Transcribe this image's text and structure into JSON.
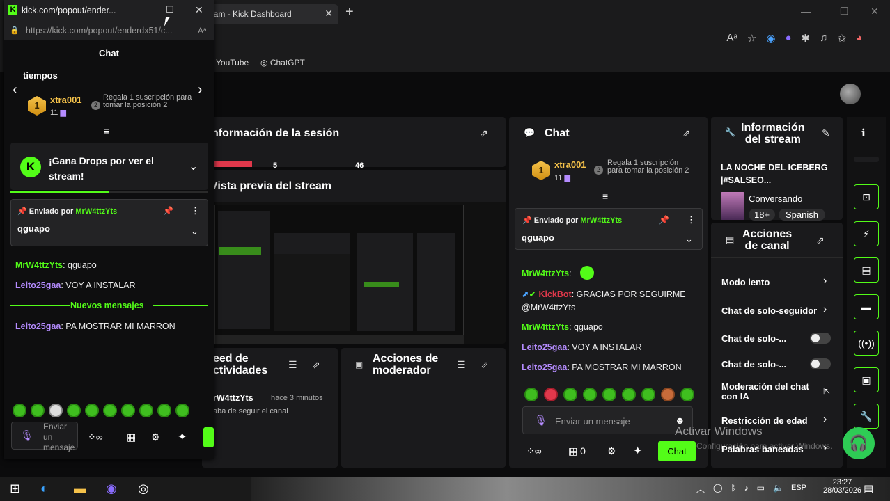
{
  "background_browser": {
    "tab_title": "eam - Kick Dashboard",
    "bookmarks": [
      "YouTube",
      "ChatGPT"
    ]
  },
  "dashboard": {
    "session_info": {
      "title": "nformación de la sesión",
      "values": [
        "5",
        "46"
      ]
    },
    "stream_preview": {
      "title": "Vista previa del stream"
    },
    "activity_feed": {
      "title": "eed de\nctividades",
      "user": "rW4ttzYts",
      "time": "hace 3 minutos",
      "event": "aba de seguir el canal"
    },
    "mod_actions": {
      "title": "Acciones de\nmoderador"
    },
    "chat": {
      "title": "Chat",
      "leader": {
        "rank": "1",
        "name": "xtra001",
        "subs": "11",
        "hint": "Regala 1 suscripción para tomar la posición 2",
        "rank2": "2"
      },
      "pinned": {
        "label": "Enviado por",
        "user": "MrW4ttzYts",
        "text": "qguapo"
      },
      "messages": [
        {
          "user": "MrW4ttzYts",
          "text": ":"
        },
        {
          "user": "KickBot",
          "text": ": GRACIAS POR SEGUIRME"
        },
        {
          "user": "",
          "text": "@MrW4ttzYts"
        },
        {
          "user": "MrW4ttzYts",
          "text": ": qguapo"
        },
        {
          "user": "Leito25gaa",
          "text": ": VOY A INSTALAR"
        },
        {
          "user": "Leito25gaa",
          "text": ": PA MOSTRAR MI MARRON"
        }
      ],
      "input_placeholder": "Enviar un mensaje",
      "gift_count": "0",
      "send_label": "Chat"
    },
    "stream_info": {
      "title": "Información\ndel stream",
      "stream_title": "LA NOCHE DEL ICEBERG |#SALSEO...",
      "category": "Conversando",
      "tags": [
        "18+",
        "Spanish"
      ]
    },
    "channel_actions": {
      "title": "Acciones\nde canal",
      "items": [
        "Modo lento",
        "Chat de solo-seguidor",
        "Chat de solo-...",
        "Chat de solo-...",
        "Moderación del chat con IA",
        "Restricción de edad",
        "Palabras baneadas"
      ]
    }
  },
  "popout": {
    "window_title": "kick.com/popout/ender...",
    "url": "https://kick.com/popout/enderdx51/c...",
    "header": "Chat",
    "leaderboard_label": "tiempos",
    "leader": {
      "rank": "1",
      "name": "xtra001",
      "subs": "11",
      "hint": "Regala 1 suscripción para tomar la posición 2",
      "rank2": "2"
    },
    "drops": {
      "text": "¡Gana Drops por ver el stream!",
      "progress": 0.5
    },
    "pinned": {
      "label": "Enviado por",
      "user": "MrW4ttzYts",
      "text": "qguapo"
    },
    "messages": [
      {
        "user": "MrW4ttzYts",
        "text": ": qguapo"
      },
      {
        "user": "Leito25gaa",
        "text": ": VOY A INSTALAR"
      }
    ],
    "new_messages_label": "Nuevos mensajes",
    "after_messages": [
      {
        "user": "Leito25gaa",
        "text": ": PA MOSTRAR MI MARRON"
      }
    ],
    "input_placeholder": "Enviar un mensaje"
  },
  "watermark": {
    "line1": "Activar Windows",
    "line2": "Configuración para activar Windows."
  },
  "taskbar": {
    "lang": "ESP",
    "time": "23:27",
    "date": "28/03/2026"
  },
  "colors": {
    "accent": "#53fc18",
    "gold": "#f5c24a",
    "purple": "#b58cff",
    "red": "#e0384b"
  }
}
